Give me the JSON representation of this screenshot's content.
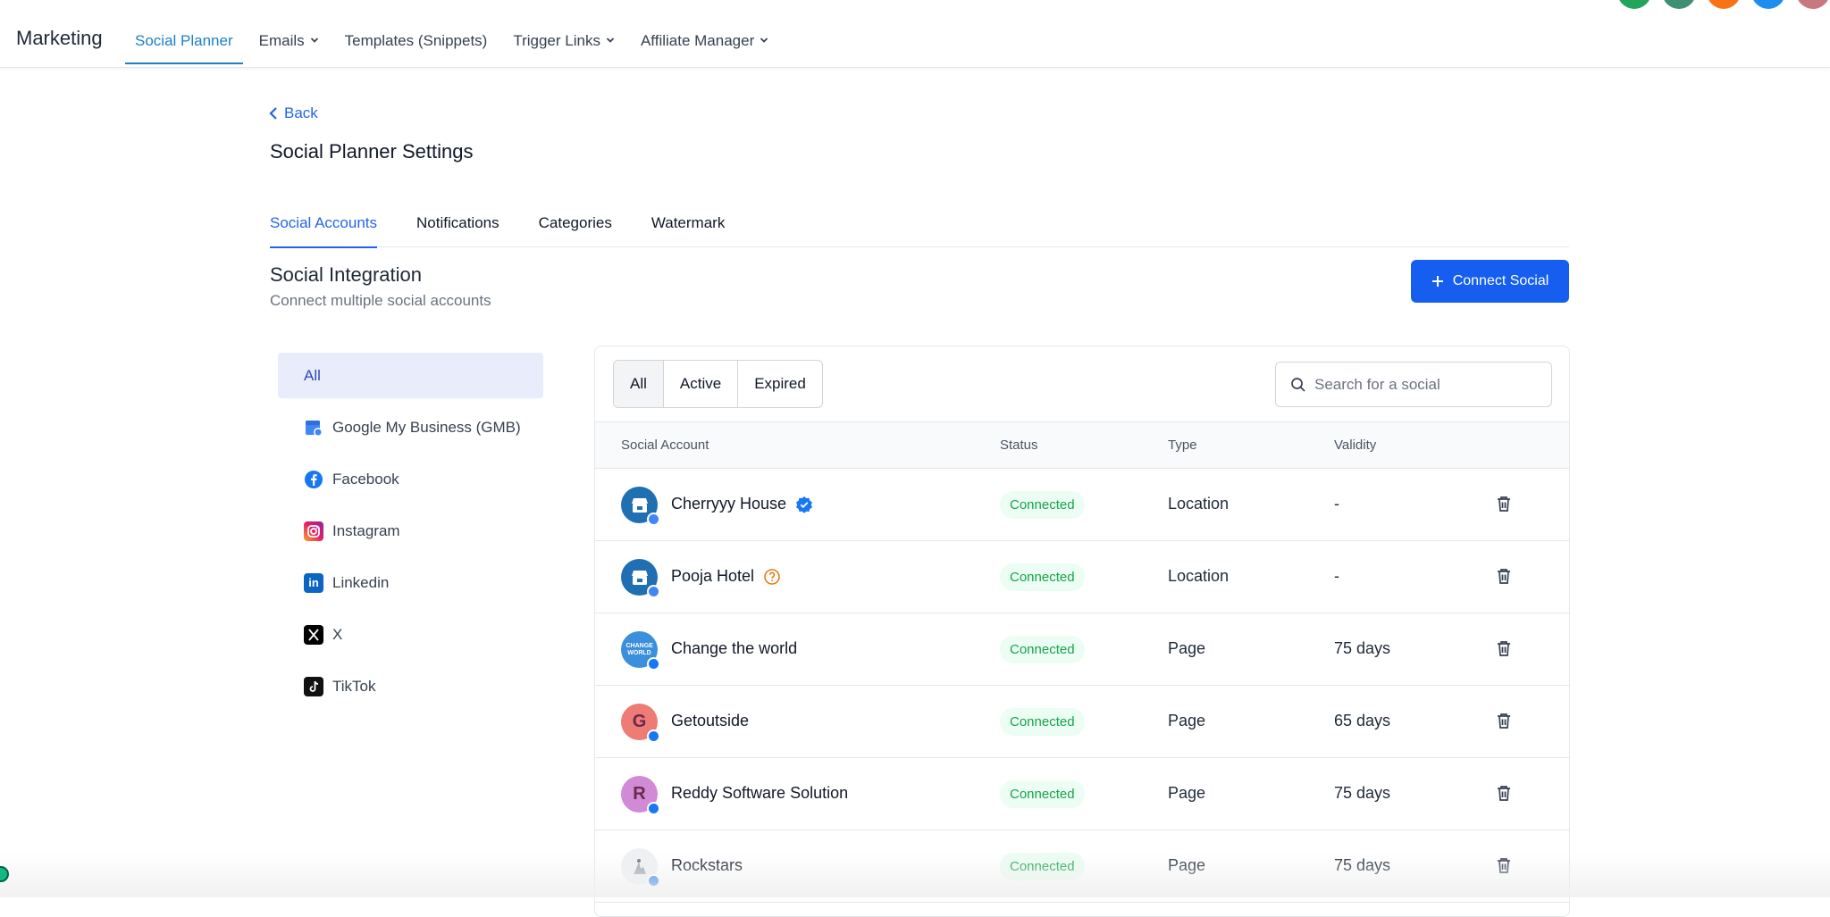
{
  "topbar": {
    "brand": "Marketing",
    "nav": [
      {
        "label": "Social Planner",
        "active": true,
        "dropdown": false
      },
      {
        "label": "Emails",
        "active": false,
        "dropdown": true
      },
      {
        "label": "Templates (Snippets)",
        "active": false,
        "dropdown": false
      },
      {
        "label": "Trigger Links",
        "active": false,
        "dropdown": true
      },
      {
        "label": "Affiliate Manager",
        "active": false,
        "dropdown": true
      }
    ],
    "avatar_colors": [
      "#22a55b",
      "#3f8f76",
      "#f97316",
      "#1d8ef0",
      "#c9787f"
    ]
  },
  "page": {
    "back_label": "Back",
    "title": "Social Planner Settings"
  },
  "tabs": [
    {
      "label": "Social Accounts",
      "active": true
    },
    {
      "label": "Notifications",
      "active": false
    },
    {
      "label": "Categories",
      "active": false
    },
    {
      "label": "Watermark",
      "active": false
    }
  ],
  "section": {
    "title": "Social Integration",
    "subtitle": "Connect multiple social accounts",
    "connect_button": "Connect Social"
  },
  "platform_filters": [
    {
      "label": "All",
      "icon": "",
      "active": true
    },
    {
      "label": "Google My Business (GMB)",
      "icon": "gmb-icon",
      "active": false
    },
    {
      "label": "Facebook",
      "icon": "facebook-icon",
      "active": false
    },
    {
      "label": "Instagram",
      "icon": "instagram-icon",
      "active": false
    },
    {
      "label": "Linkedin",
      "icon": "linkedin-icon",
      "active": false
    },
    {
      "label": "X",
      "icon": "x-icon",
      "active": false
    },
    {
      "label": "TikTok",
      "icon": "tiktok-icon",
      "active": false
    }
  ],
  "status_filters": [
    {
      "label": "All",
      "active": true
    },
    {
      "label": "Active",
      "active": false
    },
    {
      "label": "Expired",
      "active": false
    }
  ],
  "search": {
    "placeholder": "Search for a social",
    "value": ""
  },
  "table": {
    "headers": [
      "Social Account",
      "Status",
      "Type",
      "Validity"
    ],
    "rows": [
      {
        "name": "Cherryyy House",
        "avatar": "gmb",
        "avatar_text": "",
        "avatar_color": "#1f6fb2",
        "badge": "gmb",
        "name_icon": "verified-icon",
        "status": "Connected",
        "type": "Location",
        "validity": "-"
      },
      {
        "name": "Pooja Hotel",
        "avatar": "gmb",
        "avatar_text": "",
        "avatar_color": "#1f6fb2",
        "badge": "gmb",
        "name_icon": "help-circle-icon",
        "status": "Connected",
        "type": "Location",
        "validity": "-"
      },
      {
        "name": "Change the world",
        "avatar": "logo",
        "avatar_text": "CHANGE WORLD",
        "avatar_color": "#3b8fdc",
        "badge": "facebook",
        "name_icon": "",
        "status": "Connected",
        "type": "Page",
        "validity": "75 days"
      },
      {
        "name": "Getoutside",
        "avatar": "letter",
        "avatar_text": "G",
        "avatar_color": "#ee7b74",
        "badge": "facebook",
        "name_icon": "",
        "status": "Connected",
        "type": "Page",
        "validity": "65 days"
      },
      {
        "name": "Reddy Software Solution",
        "avatar": "letter",
        "avatar_text": "R",
        "avatar_color": "#d08ad6",
        "badge": "facebook",
        "name_icon": "",
        "status": "Connected",
        "type": "Page",
        "validity": "75 days"
      },
      {
        "name": "Rockstars",
        "avatar": "image",
        "avatar_text": "",
        "avatar_color": "#eef0f3",
        "badge": "facebook",
        "name_icon": "",
        "status": "Connected",
        "type": "Page",
        "validity": "75 days"
      }
    ]
  },
  "colors": {
    "primary": "#155eef",
    "nav_active": "#1d7fc9",
    "status_green": "#16a34a",
    "status_bg": "#ecfdf3",
    "filter_active_bg": "#e8ecfb"
  }
}
